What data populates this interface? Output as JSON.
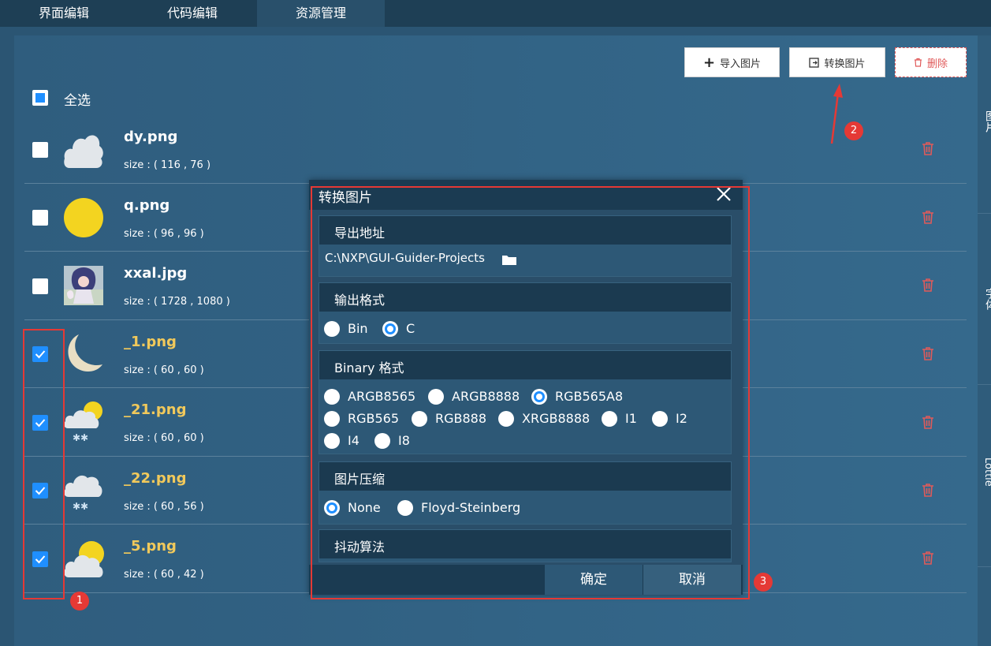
{
  "tabs": [
    {
      "label": "界面编辑"
    },
    {
      "label": "代码编辑"
    },
    {
      "label": "资源管理"
    }
  ],
  "toolbar": {
    "import_label": "导入图片",
    "convert_label": "转换图片",
    "delete_label": "删除"
  },
  "select_all": {
    "label": "全选"
  },
  "files": [
    {
      "name": "dy.png",
      "size": "size : ( 116 , 76 )",
      "checked": false
    },
    {
      "name": "q.png",
      "size": "size : ( 96 , 96 )",
      "checked": false
    },
    {
      "name": "xxal.jpg",
      "size": "size : ( 1728 , 1080 )",
      "checked": false
    },
    {
      "name": "_1.png",
      "size": "size : ( 60 , 60 )",
      "checked": true
    },
    {
      "name": "_21.png",
      "size": "size : ( 60 , 60 )",
      "checked": true
    },
    {
      "name": "_22.png",
      "size": "size : ( 60 , 56 )",
      "checked": true
    },
    {
      "name": "_5.png",
      "size": "size : ( 60 , 42 )",
      "checked": true
    }
  ],
  "dialog": {
    "title": "转换图片",
    "export": {
      "title": "导出地址",
      "path": "C:\\NXP\\GUI-Guider-Projects"
    },
    "output_format": {
      "title": "输出格式",
      "options": [
        "Bin",
        "C"
      ],
      "selected": "C"
    },
    "binary_format": {
      "title": "Binary 格式",
      "options": [
        "ARGB8565",
        "ARGB8888",
        "RGB565A8",
        "RGB565",
        "RGB888",
        "XRGB8888",
        "I1",
        "I2",
        "I4",
        "I8"
      ],
      "selected": "RGB565A8"
    },
    "compression": {
      "title": "图片压缩",
      "options": [
        "None",
        "Floyd-Steinberg"
      ],
      "selected": "None"
    },
    "dither": {
      "title": "抖动算法"
    },
    "confirm_label": "确定",
    "cancel_label": "取消"
  },
  "annotations": {
    "badge1": "1",
    "badge2": "2",
    "badge3": "3"
  },
  "right_strip": {
    "text1": "图片",
    "text2": "字体",
    "text3": "Lottie"
  },
  "colors": {
    "accent": "#1f8fff",
    "annotation": "#e53935",
    "selected_name": "#f1c95b",
    "delete": "#e05a5a"
  }
}
